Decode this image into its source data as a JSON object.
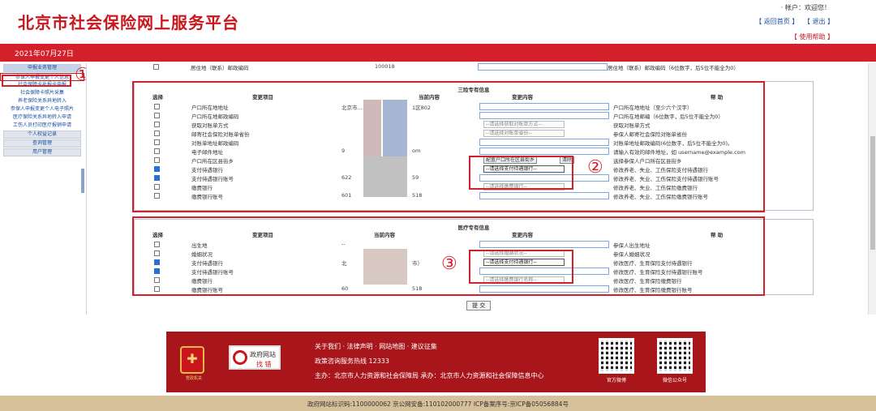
{
  "header": {
    "title": "北京市社会保险网上服务平台",
    "welcome": "· 帐户：欢迎您！",
    "links": [
      "【 返回首页 】",
      "【 退出 】"
    ],
    "links2": "【 使用帮助 】"
  },
  "redbar": {
    "date": "2021年07月27日"
  },
  "sidebar": {
    "groups": [
      "申报业务管理",
      "参保人申报变更个人信息",
      "社会保障卡补报卡申报",
      "社会保障卡照片采集",
      "养老保险关系异地转入",
      "参保人申报变更个人电子照片",
      "医疗保险关系异地转入申请",
      "工伤人员打印医疗报销申请",
      "个人权益记录",
      "查询管理",
      "用户管理"
    ]
  },
  "topfrag": {
    "item": "居住地（联系）邮政编码",
    "cur": "100018",
    "help": "居住地（联系）邮政编码（6位数字，后5位不能全为0）"
  },
  "panel1": {
    "title": "三险专有信息",
    "headers": {
      "sel": "选择",
      "item": "变更项目",
      "cur": "当前内容",
      "chg": "变更内容",
      "help": "帮 助"
    },
    "rows": [
      {
        "item": "户口所在地地址",
        "cur": "北京市…",
        "cur2": "1区802",
        "help": "户口所在地地址（至少六个汉字）"
      },
      {
        "item": "户口所在地邮政编码",
        "help": "户口所在地邮编（6位数字，后5位不能全为0）"
      },
      {
        "item": "获取对账单方式",
        "sel": "--请选择获取对账单方式--",
        "help": "获取对账单方式"
      },
      {
        "item": "邮寄社会保险对账单省份",
        "sel": "--请选择对账单省份--",
        "help": "参保人邮寄社会保险对账单省份"
      },
      {
        "item": "对账单地址邮政编码",
        "help": "对账单地址邮政编码(6位数字，后5位不能全为0)。"
      },
      {
        "item": "电子邮件地址",
        "cur": "9",
        "cur2": "om",
        "help": "请输入有效的邮件地址，如 username@example.com"
      },
      {
        "item": "户口所在区县街乡",
        "btn1": "配置户口所在区县街乡",
        "btn2": "清除",
        "help": "选择参保人户口所在区县街乡"
      },
      {
        "item": "支付待遇银行",
        "sel": "--请选择支付待遇银行--",
        "help": "修改养老、失业、工伤保险支付待遇银行"
      },
      {
        "item": "支付待遇银行账号",
        "cur": "622",
        "cur2": "59",
        "help": "修改养老、失业、工伤保险支付待遇银行账号"
      },
      {
        "item": "缴费银行",
        "sel": "--请选择缴费银行--",
        "help": "修改养老、失业、工伤保险缴费银行"
      },
      {
        "item": "缴费银行账号",
        "cur": "601",
        "cur2": "518",
        "help": "修改养老、失业、工伤保险缴费银行账号"
      }
    ]
  },
  "panel2": {
    "title": "医疗专有信息",
    "headers": {
      "sel": "选择",
      "item": "变更项目",
      "cur": "当前内容",
      "chg": "变更内容",
      "help": "帮 助"
    },
    "rows": [
      {
        "item": "出生地",
        "cur": "--",
        "help": "参保人出生地址"
      },
      {
        "item": "婚姻状况",
        "sel": "--请选择婚姻状况--",
        "help": "参保人婚姻状况"
      },
      {
        "item": "支付待遇银行",
        "cur": "北",
        "cur2": "市）",
        "sel": "--请选择支付待遇银行--",
        "help": "修改医疗、生育保险支付待遇银行"
      },
      {
        "item": "支付待遇银行账号",
        "help": "修改医疗、生育保险支付待遇银行账号"
      },
      {
        "item": "缴费银行",
        "sel": "--请选择缴费银行名称--",
        "help": "修改医疗、生育保险缴费银行"
      },
      {
        "item": "缴费银行账号",
        "cur": "60",
        "cur2": "518",
        "help": "修改医疗、生育保险缴费银行账号"
      }
    ]
  },
  "annotations": [
    "①",
    "②",
    "③"
  ],
  "submit": "提 交",
  "footer": {
    "logo1": "党政机关",
    "logo2_t1": "政府网站",
    "logo2_t2": "找 错",
    "links": "关于我们  ·  法律声明  ·  网站地图  ·  建议征集",
    "hotline": "政策咨询服务热线 12333",
    "host": "主办：北京市人力资源和社会保障局      承办：北京市人力资源和社会保障信息中心",
    "qr1": "官方微博",
    "qr2": "微信公众号"
  },
  "bottom": "政府网站标识码:1100000062    京公网安备:110102000777    ICP备案序号:京ICP备05056884号",
  "colors": {
    "brand_red": "#d4202a",
    "footer_red": "#a8151b",
    "link_blue": "#1a4fa0",
    "beige": "#d6c09a"
  }
}
